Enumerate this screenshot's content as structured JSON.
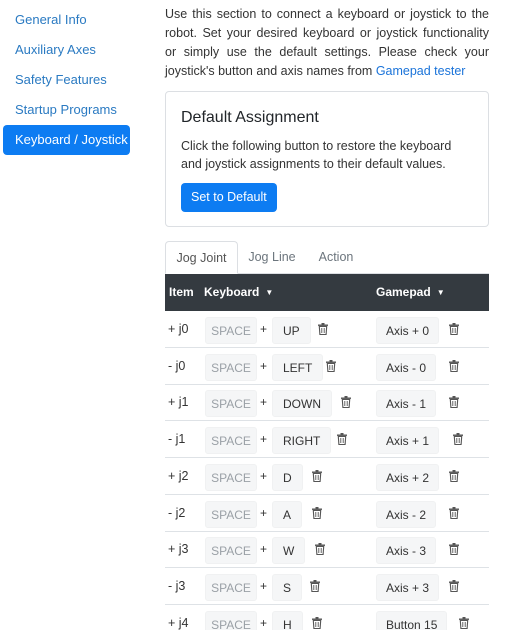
{
  "sidebar": {
    "items": [
      {
        "label": "General Info"
      },
      {
        "label": "Auxiliary Axes"
      },
      {
        "label": "Safety Features"
      },
      {
        "label": "Startup Programs"
      },
      {
        "label": "Keyboard / Joystick",
        "active": true
      }
    ]
  },
  "intro": {
    "text": "Use this section to connect a keyboard or joystick to the robot. Set your desired keyboard or joystick functionality or simply use the default settings. Please check your joystick's button and axis names from ",
    "link": "Gamepad tester"
  },
  "card": {
    "title": "Default Assignment",
    "text": "Click the following button to restore the keyboard and joystick assignments to their default values.",
    "button": "Set to Default"
  },
  "tabs": [
    {
      "label": "Jog Joint",
      "active": true
    },
    {
      "label": "Jog Line"
    },
    {
      "label": "Action"
    }
  ],
  "table": {
    "headers": {
      "item": "Item",
      "keyboard": "Keyboard",
      "gamepad": "Gamepad"
    },
    "rows": [
      {
        "item": "+ j0",
        "modifier": "SPACE",
        "key": "UP",
        "gamepad": "Axis + 0"
      },
      {
        "item": "- j0",
        "modifier": "SPACE",
        "key": "LEFT",
        "gamepad": "Axis - 0"
      },
      {
        "item": "+ j1",
        "modifier": "SPACE",
        "key": "DOWN",
        "gamepad": "Axis - 1"
      },
      {
        "item": "- j1",
        "modifier": "SPACE",
        "key": "RIGHT",
        "gamepad": "Axis + 1"
      },
      {
        "item": "+ j2",
        "modifier": "SPACE",
        "key": "D",
        "gamepad": "Axis + 2"
      },
      {
        "item": "- j2",
        "modifier": "SPACE",
        "key": "A",
        "gamepad": "Axis - 2"
      },
      {
        "item": "+ j3",
        "modifier": "SPACE",
        "key": "W",
        "gamepad": "Axis - 3"
      },
      {
        "item": "- j3",
        "modifier": "SPACE",
        "key": "S",
        "gamepad": "Axis + 3"
      },
      {
        "item": "+ j4",
        "modifier": "SPACE",
        "key": "H",
        "gamepad": "Button 15"
      }
    ],
    "plus": "+"
  },
  "colors": {
    "primary": "#0d7cf2",
    "link": "#2a7ac2",
    "header_bg": "#343a40"
  }
}
